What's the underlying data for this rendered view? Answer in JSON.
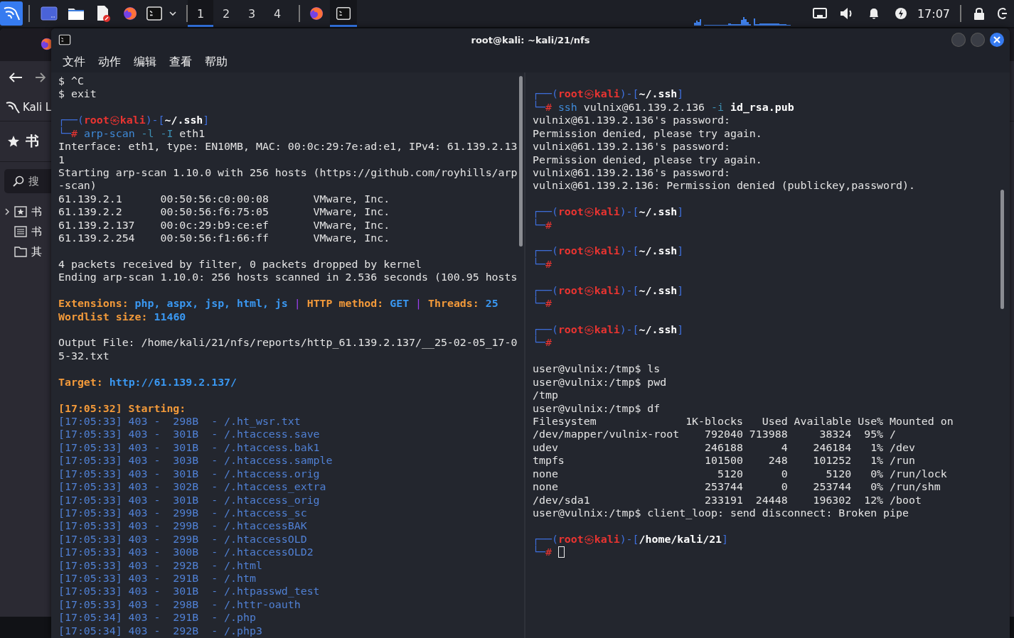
{
  "top_panel": {
    "workspaces": [
      {
        "label": "1",
        "selected": true
      },
      {
        "label": "2",
        "selected": false
      },
      {
        "label": "3",
        "selected": false
      },
      {
        "label": "4",
        "selected": false
      }
    ],
    "tasks": [
      {
        "kind": "browser",
        "selected": false
      },
      {
        "kind": "terminal",
        "selected": true
      }
    ],
    "clock": "17:07"
  },
  "browser": {
    "bookmark_link": "Kali L",
    "sidebar_title": "书",
    "search_placeholder": "搜",
    "tree": [
      {
        "kind": "toolbar",
        "label": "书"
      },
      {
        "kind": "menu",
        "label": "书"
      },
      {
        "kind": "folder",
        "label": "其"
      }
    ]
  },
  "terminal": {
    "title": "root@kali: ~kali/21/nfs",
    "menu": [
      "文件",
      "动作",
      "编辑",
      "查看",
      "帮助"
    ],
    "panes": [
      {
        "lines": [
          {
            "kind": "output",
            "text": "$ ^C"
          },
          {
            "kind": "output",
            "text": "$ exit"
          },
          {
            "kind": "blank"
          },
          {
            "kind": "segmented",
            "segments": [
              {
                "kind": "frame",
                "text": "┌──("
              },
              {
                "kind": "user",
                "text": "root"
              },
              {
                "kind": "symbol",
                "text": "㉿"
              },
              {
                "kind": "host",
                "text": "kali"
              },
              {
                "kind": "frame",
                "text": ")-["
              },
              {
                "kind": "path",
                "text": "~/.ssh"
              },
              {
                "kind": "frame",
                "text": "]"
              }
            ]
          },
          {
            "kind": "segmented",
            "segments": [
              {
                "kind": "frame",
                "text": "└─"
              },
              {
                "kind": "sign",
                "text": "# "
              },
              {
                "kind": "program",
                "text": "arp-scan"
              },
              {
                "kind": "option",
                "text": " -l -I"
              },
              {
                "kind": "argument",
                "text": " eth1"
              }
            ]
          },
          {
            "kind": "output",
            "text": "Interface: eth1, type: EN10MB, MAC: 00:0c:29:7e:ad:e1, IPv4: 61.139.2.13"
          },
          {
            "kind": "output",
            "text": "1"
          },
          {
            "kind": "output",
            "text": "Starting arp-scan 1.10.0 with 256 hosts (https://github.com/royhills/arp"
          },
          {
            "kind": "output",
            "text": "-scan)"
          },
          {
            "kind": "output",
            "text": "61.139.2.1      00:50:56:c0:00:08       VMware, Inc."
          },
          {
            "kind": "output",
            "text": "61.139.2.2      00:50:56:f6:75:05       VMware, Inc."
          },
          {
            "kind": "output",
            "text": "61.139.2.137    00:0c:29:b9:ce:ef       VMware, Inc."
          },
          {
            "kind": "output",
            "text": "61.139.2.254    00:50:56:f1:66:ff       VMware, Inc."
          },
          {
            "kind": "blank"
          },
          {
            "kind": "output",
            "text": "4 packets received by filter, 0 packets dropped by kernel"
          },
          {
            "kind": "output",
            "text": "Ending arp-scan 1.10.0: 256 hosts scanned in 2.536 seconds (100.95 hosts"
          },
          {
            "kind": "blank"
          },
          {
            "kind": "segmented",
            "segments": [
              {
                "kind": "label",
                "text": "Extensions: "
              },
              {
                "kind": "value",
                "text": "php, aspx, jsp, html, js"
              },
              {
                "kind": "divider",
                "text": " | "
              },
              {
                "kind": "label",
                "text": "HTTP method: "
              },
              {
                "kind": "value",
                "text": "GET"
              },
              {
                "kind": "divider",
                "text": " | "
              },
              {
                "kind": "label",
                "text": "Threads: "
              },
              {
                "kind": "value",
                "text": "25"
              }
            ]
          },
          {
            "kind": "segmented",
            "segments": [
              {
                "kind": "label",
                "text": "Wordlist size: "
              },
              {
                "kind": "value",
                "text": "11460"
              }
            ]
          },
          {
            "kind": "blank"
          },
          {
            "kind": "output",
            "text": "Output File: /home/kali/21/nfs/reports/http_61.139.2.137/__25-02-05_17-0"
          },
          {
            "kind": "output",
            "text": "5-32.txt"
          },
          {
            "kind": "blank"
          },
          {
            "kind": "segmented",
            "segments": [
              {
                "kind": "label",
                "text": "Target: "
              },
              {
                "kind": "value",
                "text": "http://61.139.2.137/"
              }
            ]
          },
          {
            "kind": "blank"
          },
          {
            "kind": "heading",
            "text": "[17:05:32] Starting:"
          },
          {
            "kind": "log",
            "text": "[17:05:33] 403 -  298B  - /.ht_wsr.txt"
          },
          {
            "kind": "log",
            "text": "[17:05:33] 403 -  301B  - /.htaccess.save"
          },
          {
            "kind": "log",
            "text": "[17:05:33] 403 -  301B  - /.htaccess.bak1"
          },
          {
            "kind": "log",
            "text": "[17:05:33] 403 -  303B  - /.htaccess.sample"
          },
          {
            "kind": "log",
            "text": "[17:05:33] 403 -  301B  - /.htaccess.orig"
          },
          {
            "kind": "log",
            "text": "[17:05:33] 403 -  302B  - /.htaccess_extra"
          },
          {
            "kind": "log",
            "text": "[17:05:33] 403 -  301B  - /.htaccess_orig"
          },
          {
            "kind": "log",
            "text": "[17:05:33] 403 -  299B  - /.htaccess_sc"
          },
          {
            "kind": "log",
            "text": "[17:05:33] 403 -  299B  - /.htaccessBAK"
          },
          {
            "kind": "log",
            "text": "[17:05:33] 403 -  299B  - /.htaccessOLD"
          },
          {
            "kind": "log",
            "text": "[17:05:33] 403 -  300B  - /.htaccessOLD2"
          },
          {
            "kind": "log",
            "text": "[17:05:33] 403 -  292B  - /.html"
          },
          {
            "kind": "log",
            "text": "[17:05:33] 403 -  291B  - /.htm"
          },
          {
            "kind": "log",
            "text": "[17:05:33] 403 -  301B  - /.htpasswd_test"
          },
          {
            "kind": "log",
            "text": "[17:05:33] 403 -  298B  - /.httr-oauth"
          },
          {
            "kind": "log",
            "text": "[17:05:34] 403 -  291B  - /.php"
          },
          {
            "kind": "log",
            "text": "[17:05:34] 403 -  292B  - /.php3"
          }
        ]
      },
      {
        "lines": [
          {
            "kind": "blank"
          },
          {
            "kind": "segmented",
            "segments": [
              {
                "kind": "frame",
                "text": "┌──("
              },
              {
                "kind": "user",
                "text": "root"
              },
              {
                "kind": "symbol",
                "text": "㉿"
              },
              {
                "kind": "host",
                "text": "kali"
              },
              {
                "kind": "frame",
                "text": ")-["
              },
              {
                "kind": "path",
                "text": "~/.ssh"
              },
              {
                "kind": "frame",
                "text": "]"
              }
            ]
          },
          {
            "kind": "segmented",
            "segments": [
              {
                "kind": "frame",
                "text": "└─"
              },
              {
                "kind": "sign",
                "text": "# "
              },
              {
                "kind": "program",
                "text": "ssh"
              },
              {
                "kind": "argument",
                "text": " vulnix@61.139.2.136 "
              },
              {
                "kind": "option",
                "text": "-i"
              },
              {
                "kind": "file",
                "text": " id_rsa.pub"
              }
            ]
          },
          {
            "kind": "output",
            "text": "vulnix@61.139.2.136's password:"
          },
          {
            "kind": "output",
            "text": "Permission denied, please try again."
          },
          {
            "kind": "output",
            "text": "vulnix@61.139.2.136's password:"
          },
          {
            "kind": "output",
            "text": "Permission denied, please try again."
          },
          {
            "kind": "output",
            "text": "vulnix@61.139.2.136's password:"
          },
          {
            "kind": "output",
            "text": "vulnix@61.139.2.136: Permission denied (publickey,password)."
          },
          {
            "kind": "blank"
          },
          {
            "kind": "segmented",
            "segments": [
              {
                "kind": "frame",
                "text": "┌──("
              },
              {
                "kind": "user",
                "text": "root"
              },
              {
                "kind": "symbol",
                "text": "㉿"
              },
              {
                "kind": "host",
                "text": "kali"
              },
              {
                "kind": "frame",
                "text": ")-["
              },
              {
                "kind": "path",
                "text": "~/.ssh"
              },
              {
                "kind": "frame",
                "text": "]"
              }
            ]
          },
          {
            "kind": "segmented",
            "segments": [
              {
                "kind": "frame",
                "text": "└─"
              },
              {
                "kind": "sign",
                "text": "#"
              }
            ]
          },
          {
            "kind": "blank"
          },
          {
            "kind": "segmented",
            "segments": [
              {
                "kind": "frame",
                "text": "┌──("
              },
              {
                "kind": "user",
                "text": "root"
              },
              {
                "kind": "symbol",
                "text": "㉿"
              },
              {
                "kind": "host",
                "text": "kali"
              },
              {
                "kind": "frame",
                "text": ")-["
              },
              {
                "kind": "path",
                "text": "~/.ssh"
              },
              {
                "kind": "frame",
                "text": "]"
              }
            ]
          },
          {
            "kind": "segmented",
            "segments": [
              {
                "kind": "frame",
                "text": "└─"
              },
              {
                "kind": "sign",
                "text": "#"
              }
            ]
          },
          {
            "kind": "blank"
          },
          {
            "kind": "segmented",
            "segments": [
              {
                "kind": "frame",
                "text": "┌──("
              },
              {
                "kind": "user",
                "text": "root"
              },
              {
                "kind": "symbol",
                "text": "㉿"
              },
              {
                "kind": "host",
                "text": "kali"
              },
              {
                "kind": "frame",
                "text": ")-["
              },
              {
                "kind": "path",
                "text": "~/.ssh"
              },
              {
                "kind": "frame",
                "text": "]"
              }
            ]
          },
          {
            "kind": "segmented",
            "segments": [
              {
                "kind": "frame",
                "text": "└─"
              },
              {
                "kind": "sign",
                "text": "#"
              }
            ]
          },
          {
            "kind": "blank"
          },
          {
            "kind": "segmented",
            "segments": [
              {
                "kind": "frame",
                "text": "┌──("
              },
              {
                "kind": "user",
                "text": "root"
              },
              {
                "kind": "symbol",
                "text": "㉿"
              },
              {
                "kind": "host",
                "text": "kali"
              },
              {
                "kind": "frame",
                "text": ")-["
              },
              {
                "kind": "path",
                "text": "~/.ssh"
              },
              {
                "kind": "frame",
                "text": "]"
              }
            ]
          },
          {
            "kind": "segmented",
            "segments": [
              {
                "kind": "frame",
                "text": "└─"
              },
              {
                "kind": "sign",
                "text": "#"
              }
            ]
          },
          {
            "kind": "blank"
          },
          {
            "kind": "output",
            "text": "user@vulnix:/tmp$ ls"
          },
          {
            "kind": "output",
            "text": "user@vulnix:/tmp$ pwd"
          },
          {
            "kind": "output",
            "text": "/tmp"
          },
          {
            "kind": "output",
            "text": "user@vulnix:/tmp$ df"
          },
          {
            "kind": "output",
            "text": "Filesystem              1K-blocks   Used Available Use% Mounted on"
          },
          {
            "kind": "output",
            "text": "/dev/mapper/vulnix-root    792040 713988     38324  95% /"
          },
          {
            "kind": "output",
            "text": "udev                       246188      4    246184   1% /dev"
          },
          {
            "kind": "output",
            "text": "tmpfs                      101500    248    101252   1% /run"
          },
          {
            "kind": "output",
            "text": "none                         5120      0      5120   0% /run/lock"
          },
          {
            "kind": "output",
            "text": "none                       253744      0    253744   0% /run/shm"
          },
          {
            "kind": "output",
            "text": "/dev/sda1                  233191  24448    196302  12% /boot"
          },
          {
            "kind": "output",
            "text": "user@vulnix:/tmp$ client_loop: send disconnect: Broken pipe"
          },
          {
            "kind": "blank"
          },
          {
            "kind": "segmented",
            "segments": [
              {
                "kind": "frame",
                "text": "┌──("
              },
              {
                "kind": "user",
                "text": "root"
              },
              {
                "kind": "symbol",
                "text": "㉿"
              },
              {
                "kind": "host",
                "text": "kali"
              },
              {
                "kind": "frame",
                "text": ")-["
              },
              {
                "kind": "path",
                "text": "/home/kali/21"
              },
              {
                "kind": "frame",
                "text": "]"
              }
            ]
          },
          {
            "kind": "input",
            "segments": [
              {
                "kind": "frame",
                "text": "└─"
              },
              {
                "kind": "sign",
                "text": "#"
              }
            ]
          }
        ]
      }
    ]
  }
}
